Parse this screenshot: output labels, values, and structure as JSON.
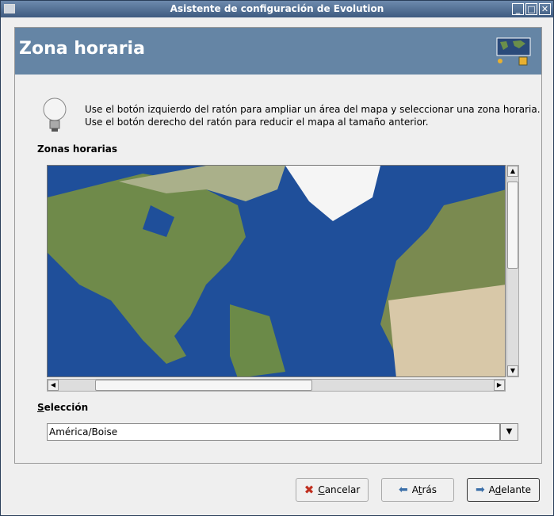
{
  "window": {
    "title": "Asistente de configuración de Evolution"
  },
  "header": {
    "title": "Zona horaria"
  },
  "intro": {
    "line1": "Use el botón izquierdo del ratón para ampliar un área del mapa y seleccionar una zona horaria.",
    "line2": "Use el botón derecho del ratón para reducir el mapa al tamaño anterior."
  },
  "map": {
    "label": "Zonas horarias"
  },
  "selection": {
    "label_u": "S",
    "label_rest": "elección",
    "value": "América/Boise"
  },
  "buttons": {
    "cancel": {
      "pre": "",
      "u": "C",
      "post": "ancelar"
    },
    "back": {
      "pre": "A",
      "u": "t",
      "post": "rás"
    },
    "forward": {
      "pre": "A",
      "u": "d",
      "post": "elante"
    }
  }
}
